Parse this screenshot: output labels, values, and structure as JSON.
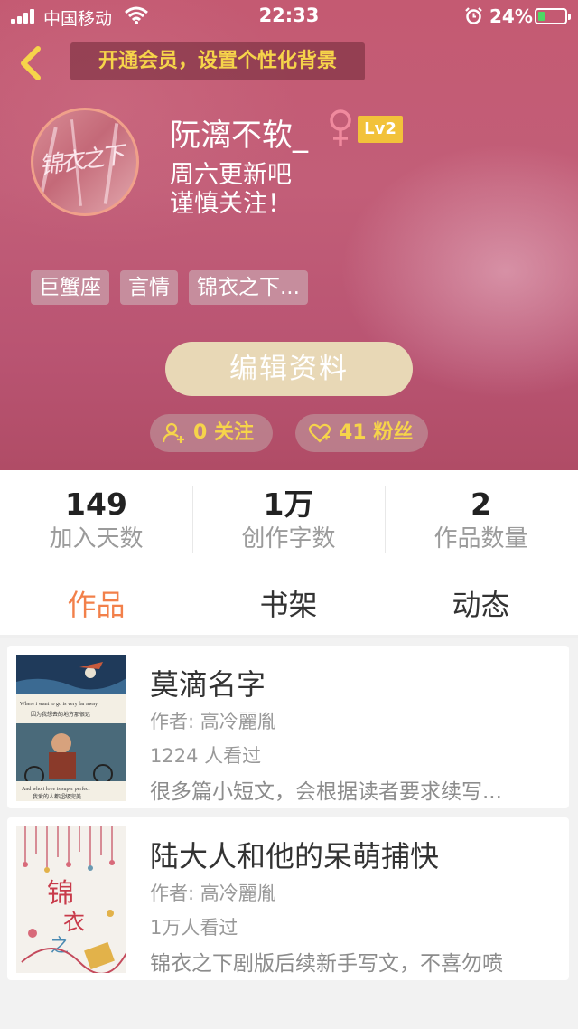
{
  "status_bar": {
    "carrier": "中国移动",
    "time": "22:33",
    "battery": "24%",
    "battery_level": 0.24
  },
  "header": {
    "vip_banner": "开通会员，设置个性化背景",
    "username": "阮漓不软_",
    "level": "Lv2",
    "bio_line1": "周六更新吧",
    "bio_line2": "谨慎关注！",
    "tags": [
      "巨蟹座",
      "言情",
      "锦衣之下..."
    ],
    "edit_button": "编辑资料",
    "following": "0 关注",
    "fans": "41 粉丝"
  },
  "stats": [
    {
      "value": "149",
      "label": "加入天数"
    },
    {
      "value": "1万",
      "label": "创作字数"
    },
    {
      "value": "2",
      "label": "作品数量"
    }
  ],
  "tabs": [
    "作品",
    "书架",
    "动态"
  ],
  "active_tab": "作品",
  "books": [
    {
      "title": "莫滴名字",
      "author": "作者: 高冷麗胤",
      "views": "1224 人看过",
      "desc": "很多篇小短文，会根据读者要求续写..."
    },
    {
      "title": "陆大人和他的呆萌捕快",
      "author": "作者: 高冷麗胤",
      "views": "1万人看过",
      "desc": "锦衣之下剧版后续新手写文，不喜勿喷"
    }
  ],
  "colors": {
    "accent": "#f2804a",
    "vip_text": "#f6d44a",
    "level_badge": "#f2c23a",
    "gender_female": "#f08a9e"
  },
  "icons": {
    "back": "chevron-left-icon",
    "gender": "female-icon",
    "follow": "add-user-icon",
    "fans": "heart-icon"
  }
}
